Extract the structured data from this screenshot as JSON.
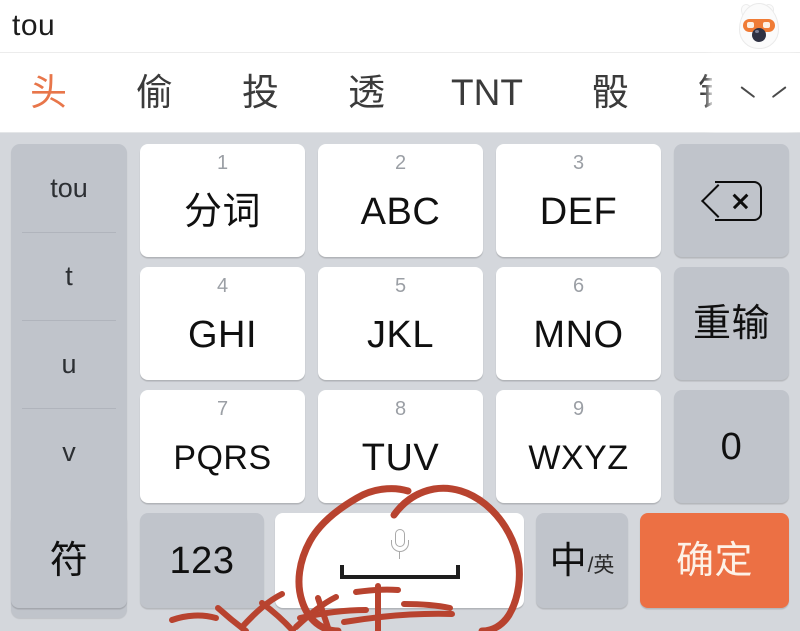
{
  "input_bar": {
    "typed_text": "tou",
    "avatar_icon": "fox-avatar-icon"
  },
  "candidate_bar": {
    "candidates": [
      {
        "text": "头",
        "selected": true
      },
      {
        "text": "偷",
        "selected": false
      },
      {
        "text": "投",
        "selected": false
      },
      {
        "text": "透",
        "selected": false
      },
      {
        "text": "TNT",
        "selected": false
      },
      {
        "text": "骰",
        "selected": false
      },
      {
        "text": "钭",
        "selected": false
      }
    ],
    "expand_icon": "chevron-down-icon",
    "selected_color": "#e8764a"
  },
  "keyboard": {
    "background_color": "#d4d7dc",
    "gray_key_color": "#c0c4cb",
    "accent_key_color": "#ec7044",
    "pinyin_panel": {
      "segments": [
        "tou",
        "t",
        "u",
        "v"
      ]
    },
    "rows": [
      {
        "keys": [
          {
            "digit": "1",
            "label": "分词",
            "style": "white"
          },
          {
            "digit": "2",
            "label": "ABC",
            "style": "white"
          },
          {
            "digit": "3",
            "label": "DEF",
            "style": "white"
          },
          {
            "digit": "",
            "label": "",
            "style": "gray",
            "icon": "backspace-icon"
          }
        ]
      },
      {
        "keys": [
          {
            "digit": "4",
            "label": "GHI",
            "style": "white"
          },
          {
            "digit": "5",
            "label": "JKL",
            "style": "white"
          },
          {
            "digit": "6",
            "label": "MNO",
            "style": "white"
          },
          {
            "digit": "",
            "label": "重输",
            "style": "gray"
          }
        ]
      },
      {
        "keys": [
          {
            "digit": "7",
            "label": "PQRS",
            "style": "white"
          },
          {
            "digit": "8",
            "label": "TUV",
            "style": "white"
          },
          {
            "digit": "9",
            "label": "WXYZ",
            "style": "white"
          },
          {
            "digit": "",
            "label": "0",
            "style": "gray"
          }
        ]
      }
    ],
    "bottom_row": {
      "symbol_key": "符",
      "number_key": "123",
      "space_key": {
        "mic_icon": "microphone-icon",
        "space_icon": "space-bar-icon"
      },
      "lang_key": {
        "main": "中",
        "sub": "/英"
      },
      "confirm_key": "确定"
    }
  },
  "annotation": {
    "ink_color": "#b8432f",
    "shape": "hand-drawn-circle-around-space-key",
    "handwriting": "切换键盘"
  }
}
